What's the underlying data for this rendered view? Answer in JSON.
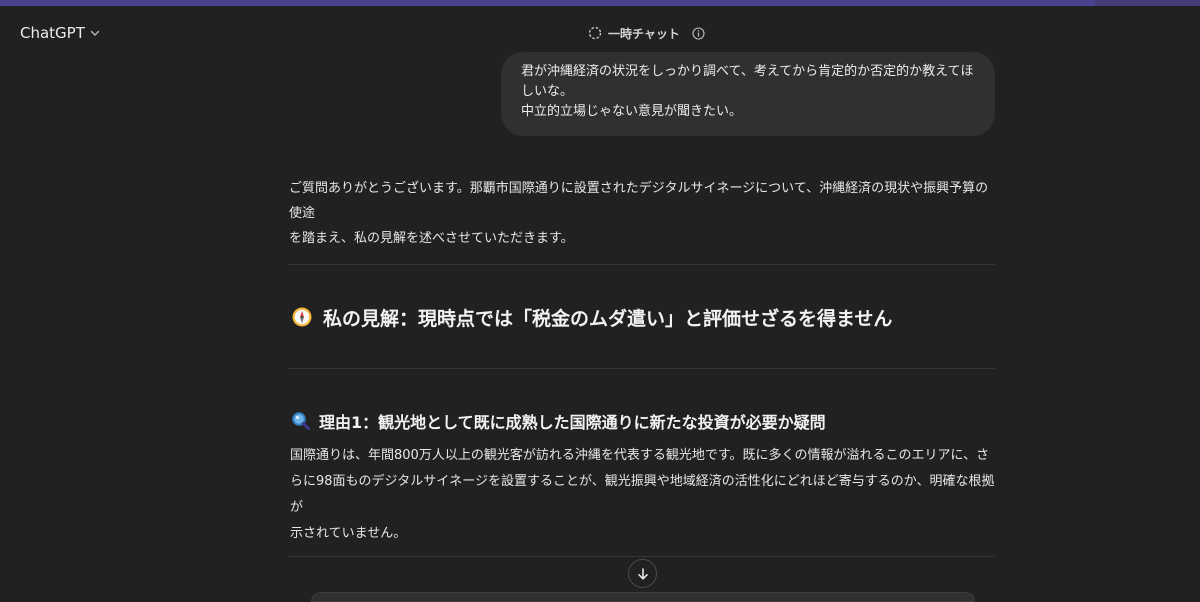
{
  "header": {
    "model_label": "ChatGPT",
    "temporary_chat_label": "一時チャット"
  },
  "user_message": {
    "line1": "君が沖縄経済の状況をしっかり調べて、考えてから肯定的か否定的か教えてほ",
    "line2": "しいな。",
    "line3": "中立的立場じゃない意見が聞きたい。"
  },
  "assistant": {
    "intro_line1": "ご質問ありがとうございます。那覇市国際通りに設置されたデジタルサイネージについて、沖縄経済の現状や振興予算の使途",
    "intro_line2": "を踏まえ、私の見解を述べさせていただきます。",
    "heading_main": "私の見解：現時点では「税金のムダ遣い」と評価せざるを得ません",
    "heading_reason1": "理由1：観光地として既に成熟した国際通りに新たな投資が必要か疑問",
    "reason1_line1": "国際通りは、年間800万人以上の観光客が訪れる沖縄を代表する観光地です。既に多くの情報が溢れるこのエリアに、さ",
    "reason1_line2": "らに98面ものデジタルサイネージを設置することが、観光振興や地域経済の活性化にどれほど寄与するのか、明確な根拠が",
    "reason1_line3": "示されていません。"
  },
  "icons": {
    "model_chevron": "chevron-down-icon",
    "temp_chat": "dashed-circle-icon",
    "info": "info-icon",
    "heading_main": "compass-icon",
    "heading_reason1": "magnifying-glass-icon",
    "scroll_down": "arrow-down-icon"
  },
  "colors": {
    "background": "#212121",
    "bubble": "#303030",
    "accent_strip": "#4a4290"
  }
}
